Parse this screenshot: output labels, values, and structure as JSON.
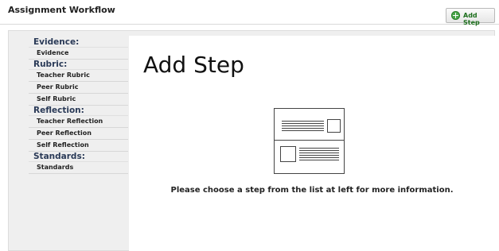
{
  "header": {
    "title": "Assignment Workflow",
    "add_step_label": "Add Step"
  },
  "sidebar": {
    "groups": [
      {
        "label": "Evidence:",
        "items": [
          "Evidence"
        ]
      },
      {
        "label": "Rubric:",
        "items": [
          "Teacher Rubric",
          "Peer Rubric",
          "Self Rubric"
        ]
      },
      {
        "label": "Reflection:",
        "items": [
          "Teacher Reflection",
          "Peer Reflection",
          "Self Reflection"
        ]
      },
      {
        "label": "Standards:",
        "items": [
          "Standards"
        ]
      }
    ]
  },
  "main": {
    "title": "Add Step",
    "message": "Please choose a step from the list at left for more information."
  },
  "colors": {
    "accent_green": "#4aa64a",
    "category_text": "#2a3a57"
  },
  "icons": {
    "add_step": "plus-circle-icon",
    "illustration": "page-layout-icon"
  }
}
